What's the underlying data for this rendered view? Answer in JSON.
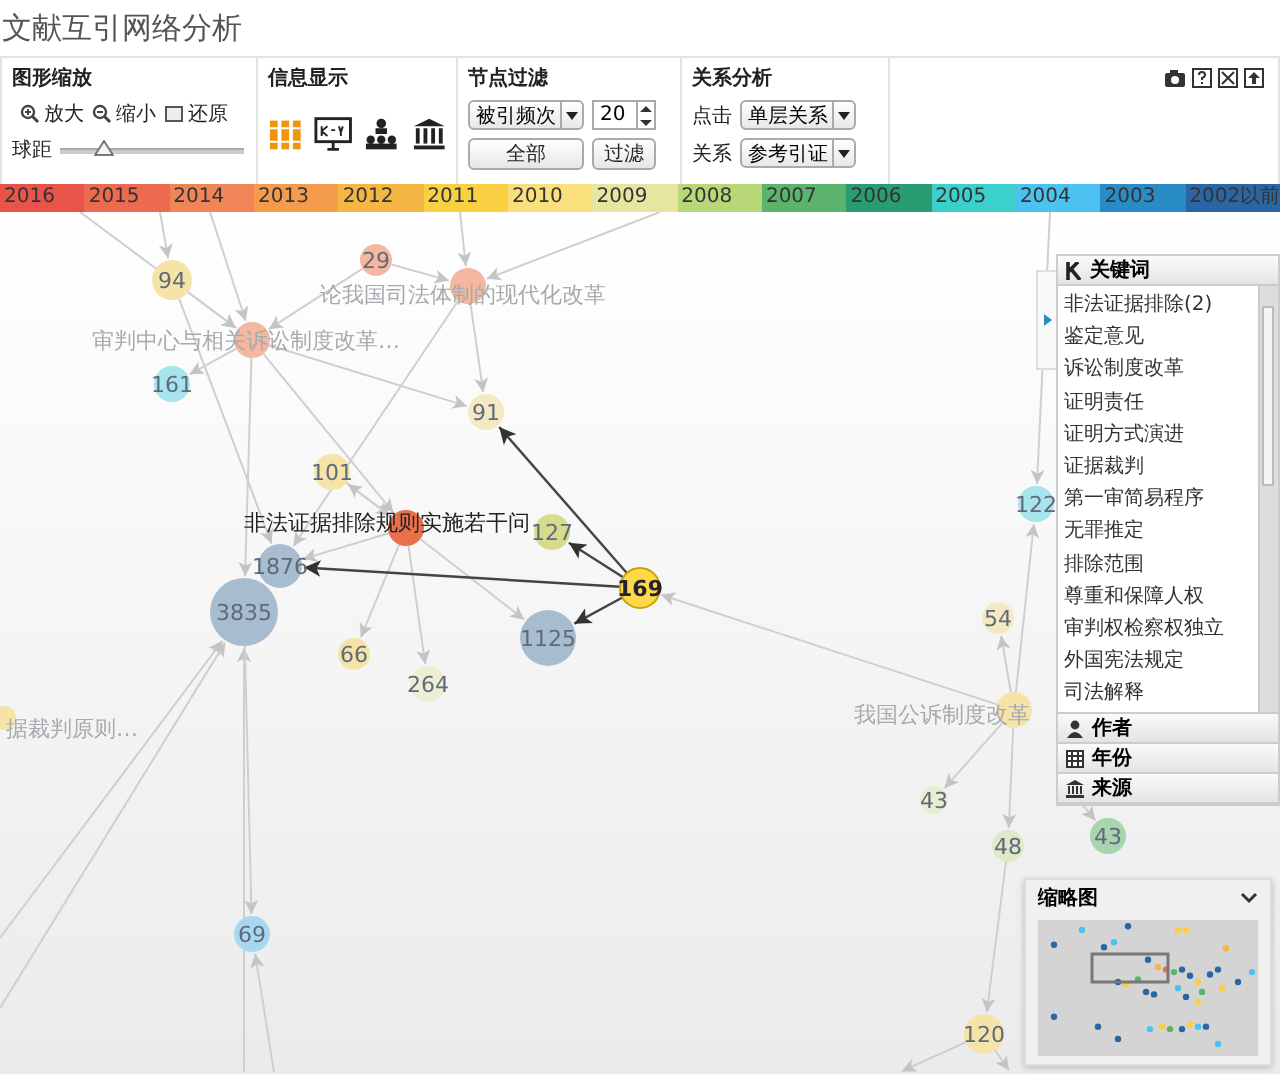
{
  "title": "文献互引网络分析",
  "zoom": {
    "heading": "图形缩放",
    "buttons": [
      "放大",
      "缩小",
      "还原"
    ],
    "distance_label": "球距",
    "distance": {
      "level": 0.24
    }
  },
  "info": {
    "heading": "信息显示"
  },
  "filter": {
    "heading": "节点过滤",
    "sort": "被引频次",
    "count": "20",
    "buttons": [
      "全部",
      "过滤"
    ]
  },
  "relation": {
    "heading": "关系分析",
    "rows": [
      {
        "label": "点击",
        "value": "单层关系"
      },
      {
        "label": "关系",
        "value": "参考引证"
      }
    ]
  },
  "years": [
    {
      "label": "2016",
      "color": "#e8544a"
    },
    {
      "label": "2015",
      "color": "#ec6a4e"
    },
    {
      "label": "2014",
      "color": "#f08658"
    },
    {
      "label": "2013",
      "color": "#f49c4c"
    },
    {
      "label": "2012",
      "color": "#f6b644"
    },
    {
      "label": "2011",
      "color": "#f8d042"
    },
    {
      "label": "2010",
      "color": "#fae07c"
    },
    {
      "label": "2009",
      "color": "#e6e6a0"
    },
    {
      "label": "2008",
      "color": "#b8d878"
    },
    {
      "label": "2007",
      "color": "#5cb46c"
    },
    {
      "label": "2006",
      "color": "#2a9c72"
    },
    {
      "label": "2005",
      "color": "#3cd0cc"
    },
    {
      "label": "2004",
      "color": "#4cc2f0"
    },
    {
      "label": "2003",
      "color": "#2a8cc6"
    },
    {
      "label": "2002以前",
      "color": "#2a66a4"
    }
  ],
  "graph": {
    "nodes": [
      {
        "label": "94",
        "color": "#f5e3a8",
        "selected": false
      },
      {
        "label": "29",
        "color": "#f4b8a0",
        "selected": false
      },
      {
        "color": "#f4b8a0",
        "selected": false
      },
      {
        "color": "#f4b8a0",
        "selected": false
      },
      {
        "label": "161",
        "color": "#a8e4ee",
        "selected": false
      },
      {
        "label": "91",
        "color": "#f5e9c4",
        "selected": false
      },
      {
        "label": "101",
        "color": "#f5e3a8",
        "selected": false
      },
      {
        "color": "#e8704a",
        "selected": false
      },
      {
        "label": "127",
        "color": "#d7dc8c",
        "selected": false
      },
      {
        "label": "1876",
        "color": "#a8bccf",
        "selected": false
      },
      {
        "label": "169",
        "color": "#ffd84a",
        "selected": true
      },
      {
        "label": "3835",
        "color": "#a8bccf",
        "selected": false
      },
      {
        "label": "1125",
        "color": "#a8bccf",
        "selected": false
      },
      {
        "label": "66",
        "color": "#f5e3a8",
        "selected": false
      },
      {
        "label": "264",
        "color": "#eeeed4",
        "selected": false
      },
      {
        "label": "122",
        "color": "#a8e4ee",
        "selected": false
      },
      {
        "label": "54",
        "color": "#f5e9c4",
        "selected": false
      },
      {
        "color": "#f5e3a8",
        "selected": false
      },
      {
        "label": "43",
        "color": "#e8efd0",
        "selected": false
      },
      {
        "label": "43",
        "color": "#a8d4b0",
        "selected": false
      },
      {
        "label": "48",
        "color": "#dfe8c8",
        "selected": false
      },
      {
        "label": "69",
        "color": "#a8d8f0",
        "selected": false
      },
      {
        "label": "120",
        "color": "#f5e3a8",
        "selected": false
      },
      {
        "color": "#f5e3a8",
        "selected": false
      }
    ],
    "titles": [
      {
        "text": "论我国司法体制的现代化改革",
        "selected": false
      },
      {
        "text": "审判中心与相关诉讼制度改革…",
        "selected": false
      },
      {
        "text": "非法证据排除规则实施若干问",
        "selected": true
      },
      {
        "text": "据裁判原则…",
        "selected": false
      },
      {
        "text": "我国公诉制度改革",
        "selected": false
      }
    ]
  },
  "keywords": {
    "heading": "关键词",
    "items": [
      "非法证据排除(2)",
      "鉴定意见",
      "诉讼制度改革",
      "证明责任",
      "证明方式演进",
      "证据裁判",
      "第一审简易程序",
      "无罪推定",
      "排除范围",
      "尊重和保障人权",
      "审判权检察权独立",
      "外国宪法规定",
      "司法解释"
    ]
  },
  "facets": [
    "作者",
    "年份",
    "来源"
  ],
  "minimap": {
    "heading": "缩略图"
  }
}
